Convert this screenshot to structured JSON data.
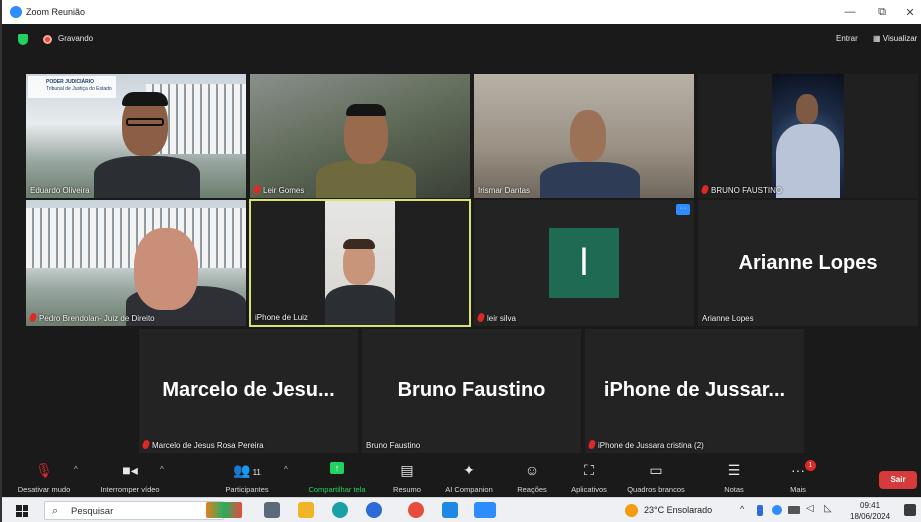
{
  "window": {
    "title": "Zoom Reunião",
    "min": "—",
    "max": "⧉",
    "close": "✕"
  },
  "meeting": {
    "recording_label": "Gravando",
    "enter_label": "Entrar",
    "view_label": "Visualizar"
  },
  "tiles": [
    {
      "name": "Eduardo Oliveira",
      "type": "video",
      "muted": false
    },
    {
      "name": "Leir Gomes",
      "type": "video",
      "muted": true
    },
    {
      "name": "Irismar Dantas",
      "type": "video",
      "muted": false
    },
    {
      "name": "BRUNO FAUSTINO",
      "type": "video",
      "muted": true
    },
    {
      "name": "Pedro Brendolan- Juiz de Direito",
      "type": "video",
      "muted": true
    },
    {
      "name": "iPhone de Luiz",
      "type": "video",
      "muted": false,
      "active_speaker": true
    },
    {
      "name": "leir silva",
      "type": "avatar",
      "muted": true,
      "initial": "l",
      "avatar_color": "#1f6a53"
    },
    {
      "name": "Arianne Lopes",
      "type": "name-only",
      "muted": false,
      "display": "Arianne Lopes"
    },
    {
      "name": "Marcelo de Jesus Rosa Pereira",
      "type": "name-only",
      "muted": true,
      "display": "Marcelo de Jesu..."
    },
    {
      "name": "Bruno Faustino",
      "type": "name-only",
      "muted": false,
      "display": "Bruno Faustino"
    },
    {
      "name": "iPhone de Jussara cristina (2)",
      "type": "name-only",
      "muted": true,
      "display": "iPhone de Jussar..."
    }
  ],
  "court_header": {
    "line1": "PODER JUDICIÁRIO",
    "line2": "Tribunal de Justiça do Estado"
  },
  "toolbar": {
    "mute": "Desativar mudo",
    "video": "Interromper vídeo",
    "participants": "Participantes",
    "participants_count": "11",
    "share": "Compartilhar tela",
    "summary": "Resumo",
    "companion": "AI Companion",
    "reactions": "Reações",
    "apps": "Aplicativos",
    "whiteboards": "Quadros brancos",
    "notes": "Notas",
    "more": "Mais",
    "more_badge": "1",
    "leave": "Sair"
  },
  "taskbar": {
    "search_placeholder": "Pesquisar",
    "weather": "23°C  Ensolarado",
    "time": "09:41",
    "date": "18/06/2024"
  },
  "colors": {
    "accent": "#2d8cff",
    "share_green": "#23d160",
    "leave_red": "#d73a3a",
    "speaker_border": "#d7e36b"
  }
}
